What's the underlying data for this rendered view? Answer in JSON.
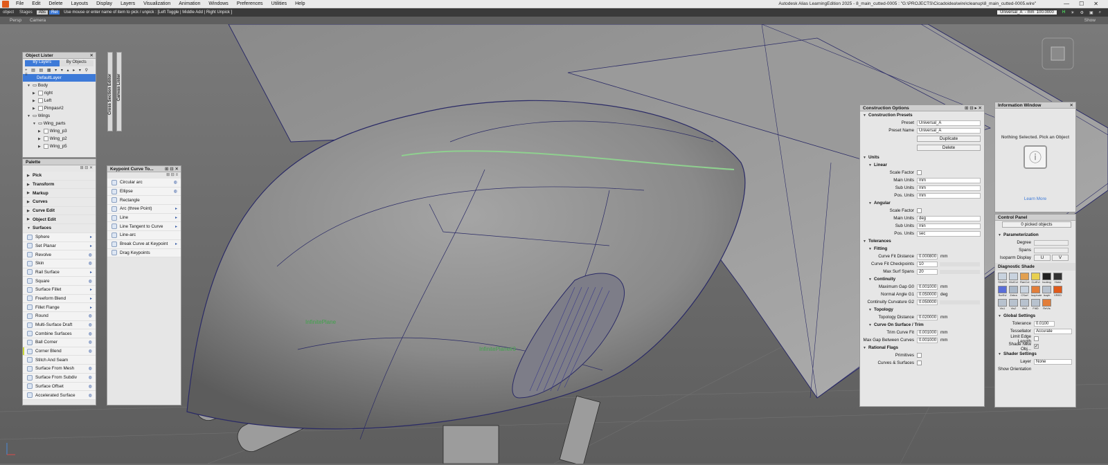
{
  "menubar": {
    "items": [
      "File",
      "Edit",
      "Delete",
      "Layouts",
      "Display",
      "Layers",
      "Visualization",
      "Animation",
      "Windows",
      "Preferences",
      "Utilities",
      "Help"
    ],
    "title": "Autodesk Alias LearningEdition 2025   -  8_main_cutted-0005 : \"G:\\PROJECTS\\Cicadoidea\\wire\\cleanup\\8_main_cutted-0005.wire\""
  },
  "toolbar": {
    "pick_mode": "object",
    "stages": "Stages",
    "abs": "Abs",
    "rel": "Rel",
    "prompt": "Use mouse or enter name of item to pick / unpick : [Left Toggle | Middle Add | Right Unpick ]",
    "preset": "Universal_A",
    "units": "mm",
    "scale": "100.0000",
    "h_indicator": "H"
  },
  "viewport_bar": {
    "left": "Persp",
    "camera": "Camera",
    "show": "Show"
  },
  "viewport_labels": {
    "plane1": "InfinitePlane",
    "plane2": "InfinitePlane#3"
  },
  "object_lister": {
    "title": "Object Lister",
    "tab_layers": "By Layers",
    "tab_objects": "By Objects",
    "items": [
      {
        "label": "DefaultLayer",
        "level": 0,
        "selected": true
      },
      {
        "label": "Body",
        "level": 0
      },
      {
        "label": "right",
        "level": 1
      },
      {
        "label": "Left",
        "level": 1
      },
      {
        "label": "Pimpas#2",
        "level": 1
      },
      {
        "label": "Wings",
        "level": 0
      },
      {
        "label": "Wing_parts",
        "level": 1
      },
      {
        "label": "Wing_p3",
        "level": 2
      },
      {
        "label": "Wing_p2",
        "level": 2
      },
      {
        "label": "Wing_p5",
        "level": 2
      }
    ]
  },
  "side_tabs": {
    "cross_section": "Cross Section Editor",
    "canvas": "Canvas Lister"
  },
  "palette": {
    "title": "Palette",
    "groups": [
      "Pick",
      "Transform",
      "Markup",
      "Curves",
      "Curve Edit",
      "Object Edit",
      "Surfaces"
    ],
    "surfaces": [
      "Sphere",
      "Set Planar",
      "Revolve",
      "Skin",
      "Rail Surface",
      "Square",
      "Surface Fillet",
      "Freeform Blend",
      "Fillet Flange",
      "Round",
      "Multi-Surface Draft",
      "Combine Surfaces",
      "Ball Corner",
      "Corner Blend",
      "Stitch And Seam",
      "Surface From Mesh",
      "Surface From Subdiv",
      "Surface Offset",
      "Accelerated Surface"
    ]
  },
  "keypoint": {
    "title": "Keypoint Curve To...",
    "items": [
      "Circular arc",
      "Ellipse",
      "Rectangle",
      "Arc (three Point)",
      "Line",
      "Line Tangent to Curve",
      "Line-arc",
      "Break Curve at Keypoint",
      "Drag Keypoints"
    ]
  },
  "construction": {
    "title": "Construction Options",
    "presets_header": "Construction Presets",
    "preset_label": "Preset",
    "preset_value": "Universal_A",
    "preset_name_label": "Preset Name",
    "preset_name_value": "Universal_A",
    "duplicate": "Duplicate",
    "delete": "Delete",
    "units_header": "Units",
    "linear_header": "Linear",
    "scale_factor": "Scale Factor",
    "main_units": "Main Units",
    "sub_units": "Sub Units",
    "pos_units": "Pos. Units",
    "linear_main": "mm",
    "linear_sub": "mm",
    "linear_pos": "mm",
    "angular_header": "Angular",
    "angular_main": "deg",
    "angular_sub": "min",
    "angular_pos": "sec",
    "tolerances_header": "Tolerances",
    "fitting_header": "Fitting",
    "curve_fit_distance": "Curve Fit Distance",
    "curve_fit_distance_val": "0.000800",
    "curve_fit_distance_unit": "mm",
    "curve_fit_checkpoints": "Curve Fit Checkpoints",
    "curve_fit_checkpoints_val": "10",
    "max_surf_spans": "Max Surf Spans",
    "max_surf_spans_val": "20",
    "continuity_header": "Continuity",
    "max_gap": "Maximum Gap G0",
    "max_gap_val": "0.001000",
    "max_gap_unit": "mm",
    "normal_angle": "Normal Angle G1",
    "normal_angle_val": "0.050000",
    "normal_angle_unit": "deg",
    "continuity_g2": "Continuity Curvature G2",
    "continuity_g2_val": "0.050000",
    "topology_header": "Topology",
    "topology_distance": "Topology Distance",
    "topology_distance_val": "0.020000",
    "topology_distance_unit": "mm",
    "cos_header": "Curve On Surface / Trim",
    "trim_curve_fit": "Trim Curve Fit",
    "trim_curve_fit_val": "0.001000",
    "trim_curve_fit_unit": "mm",
    "max_gap_between": "Max Gap Between Curves",
    "max_gap_between_val": "0.001000",
    "max_gap_between_unit": "mm",
    "rational_header": "Rational Flags",
    "primitives": "Primitives",
    "curves_surfaces": "Curves & Surfaces"
  },
  "info_window": {
    "title": "Information Window",
    "message": "Nothing Selected. Pick an Object",
    "learn_more": "Learn More"
  },
  "control_panel": {
    "title": "Control Panel",
    "picked": "0 picked objects",
    "param_header": "Parameterization",
    "degree": "Degree",
    "spans": "Spans",
    "isoparm": "Isoparm Display",
    "u": "U",
    "v": "V",
    "diag_header": "Diagnostic Shade",
    "diag_icons": [
      "ShdOff",
      "MulCol",
      "RanCol",
      "CurEvl",
      "IsoAng",
      "Horiz",
      "SurEvl",
      "Zebra",
      "CSurf",
      "Isophote",
      "Isoph",
      "VRED",
      "Vis1",
      "Vis2",
      "Vis3",
      "FiltD",
      "ReVis"
    ],
    "global_header": "Global Settings",
    "tolerance": "Tolerance",
    "tolerance_val": "0.0100",
    "tessellator": "Tessellator",
    "tessellator_val": "Accurate",
    "limit_edge": "Limit Edge Length",
    "shade_new": "Shade New Obj...",
    "shader_header": "Shader Settings",
    "layer": "Layer",
    "layer_val": "None",
    "show_orientation": "Show Orientation"
  },
  "colors": {
    "accent": "#3d7ad8",
    "panel": "#e6e6e6",
    "viewport": "#6d6d6d",
    "brand": "#e05a1b"
  }
}
